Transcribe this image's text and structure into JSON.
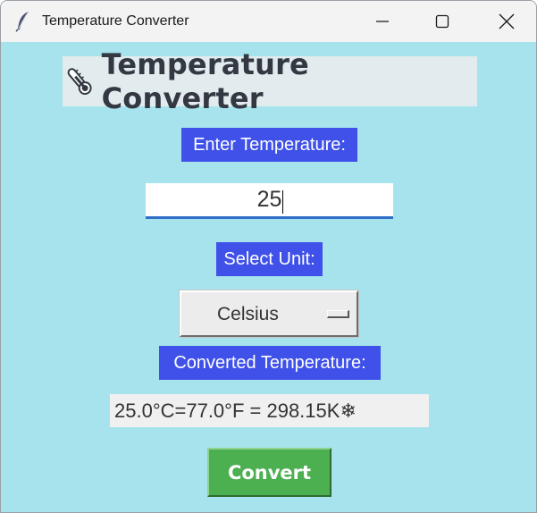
{
  "window": {
    "title": "Temperature Converter"
  },
  "heading": {
    "icon": "thermometer-icon",
    "text": "Temperature Converter"
  },
  "labels": {
    "enter": "Enter Temperature:",
    "unit": "Select Unit:",
    "converted": "Converted Temperature:"
  },
  "input": {
    "value": "25"
  },
  "unit_select": {
    "selected": "Celsius"
  },
  "result": {
    "text": "25.0°C=77.0°F = 298.15K❄"
  },
  "convert_button": {
    "label": "Convert"
  },
  "colors": {
    "background": "#a6e3ec",
    "label_bg": "#3f51e8",
    "button_bg": "#4caf50"
  }
}
